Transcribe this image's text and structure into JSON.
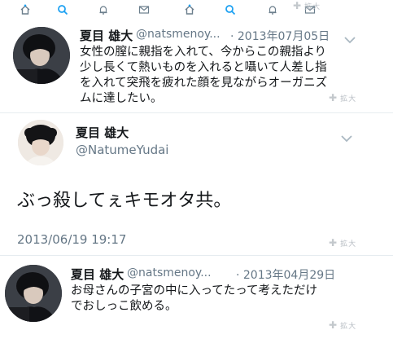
{
  "nav_icons": [
    "home-icon",
    "search-icon",
    "notifications-bell-icon",
    "messages-envelope-icon"
  ],
  "zoom_label": "拡大",
  "tweet1": {
    "display_name": "夏目 雄大",
    "handle": "@natsmenoy...",
    "date": "· 2013年07月05日",
    "lines": [
      "女性の膣に親指を入れて、今からこの親指より",
      "少し長くて熱いものを入れると囁いて人差し指",
      "を入れて突飛を疲れた顔を見ながらオーガニズ",
      "ムに達したい。"
    ]
  },
  "tweet2": {
    "display_name": "夏目 雄大",
    "handle": "@NatumeYudai",
    "text": "ぶっ殺してぇキモオタ共。",
    "timestamp": "2013/06/19 19:17"
  },
  "tweet3": {
    "display_name": "夏目 雄大",
    "handle": "@natsmenoy...",
    "date": "· 2013年04月29日",
    "lines": [
      "お母さんの子宮の中に入ってたって考えただけ",
      "でおしっこ飲める。"
    ]
  },
  "colors": {
    "accent": "#1da1f2",
    "secondary": "#657786",
    "text": "#14171a",
    "chevron": "#aab8c2"
  }
}
